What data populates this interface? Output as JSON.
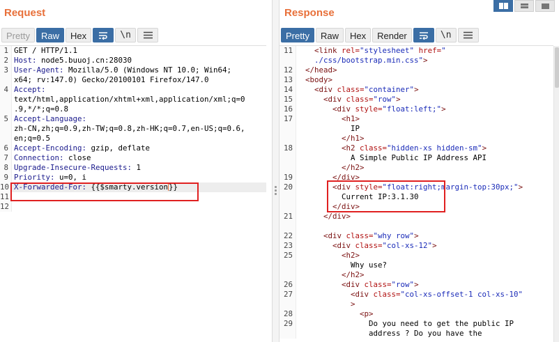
{
  "request": {
    "title": "Request",
    "tabs": [
      {
        "label": "Pretty"
      },
      {
        "label": "Raw"
      },
      {
        "label": "Hex"
      }
    ],
    "active_tab": "Raw",
    "icons": [
      "wrap-lines-icon",
      "newline-icon",
      "menu-icon"
    ],
    "newline_glyph": "\\n",
    "lines": [
      {
        "num": "1",
        "segs": [
          {
            "t": "GET / HTTP/1.1",
            "c": ""
          }
        ]
      },
      {
        "num": "2",
        "segs": [
          {
            "t": "Host: ",
            "c": "k"
          },
          {
            "t": "node5.buuoj.cn:28030",
            "c": ""
          }
        ]
      },
      {
        "num": "3",
        "segs": [
          {
            "t": "User-Agent: ",
            "c": "k"
          },
          {
            "t": "Mozilla/5.0 (Windows NT 10.0; Win64;",
            "c": ""
          }
        ]
      },
      {
        "num": "",
        "segs": [
          {
            "t": "x64; rv:147.0) Gecko/20100101 Firefox/147.0",
            "c": ""
          }
        ]
      },
      {
        "num": "4",
        "segs": [
          {
            "t": "Accept:",
            "c": "k"
          }
        ]
      },
      {
        "num": "",
        "segs": [
          {
            "t": "text/html,application/xhtml+xml,application/xml;q=0",
            "c": ""
          }
        ]
      },
      {
        "num": "",
        "segs": [
          {
            "t": ".9,*/*;q=0.8",
            "c": ""
          }
        ]
      },
      {
        "num": "5",
        "segs": [
          {
            "t": "Accept-Language:",
            "c": "k"
          }
        ]
      },
      {
        "num": "",
        "segs": [
          {
            "t": "zh-CN,zh;q=0.9,zh-TW;q=0.8,zh-HK;q=0.7,en-US;q=0.6,",
            "c": ""
          }
        ]
      },
      {
        "num": "",
        "segs": [
          {
            "t": "en;q=0.5",
            "c": ""
          }
        ]
      },
      {
        "num": "6",
        "segs": [
          {
            "t": "Accept-Encoding: ",
            "c": "k"
          },
          {
            "t": "gzip, deflate",
            "c": ""
          }
        ]
      },
      {
        "num": "7",
        "segs": [
          {
            "t": "Connection: ",
            "c": "k"
          },
          {
            "t": "close",
            "c": ""
          }
        ]
      },
      {
        "num": "8",
        "segs": [
          {
            "t": "Upgrade-Insecure-Requests: ",
            "c": "k"
          },
          {
            "t": "1",
            "c": ""
          }
        ]
      },
      {
        "num": "9",
        "segs": [
          {
            "t": "Priority: ",
            "c": "k"
          },
          {
            "t": "u=0, i",
            "c": ""
          }
        ]
      },
      {
        "num": "10",
        "segs": [
          {
            "t": "X-Forwarded-For: ",
            "c": "k"
          },
          {
            "t": "{{$smarty.version",
            "c": ""
          },
          {
            "t": "|caret|",
            "c": "caret"
          },
          {
            "t": "}}",
            "c": ""
          }
        ],
        "current": true
      },
      {
        "num": "11",
        "segs": []
      },
      {
        "num": "12",
        "segs": []
      }
    ]
  },
  "response": {
    "title": "Response",
    "tabs": [
      {
        "label": "Pretty"
      },
      {
        "label": "Raw"
      },
      {
        "label": "Hex"
      },
      {
        "label": "Render"
      }
    ],
    "active_tab": "Pretty",
    "icons": [
      "wrap-lines-icon",
      "newline-icon",
      "menu-icon"
    ],
    "newline_glyph": "\\n",
    "lines": [
      {
        "num": "11",
        "segs": [
          {
            "t": "    ",
            "c": ""
          },
          {
            "t": "<link ",
            "c": "t"
          },
          {
            "t": "rel=",
            "c": "a"
          },
          {
            "t": "\"stylesheet\" ",
            "c": "v"
          },
          {
            "t": "href=",
            "c": "a"
          },
          {
            "t": "\"",
            "c": "v"
          }
        ]
      },
      {
        "num": "",
        "segs": [
          {
            "t": "    ",
            "c": ""
          },
          {
            "t": "./css/bootstrap.min.css\"",
            "c": "v"
          },
          {
            "t": ">",
            "c": "t"
          }
        ]
      },
      {
        "num": "12",
        "segs": [
          {
            "t": "  ",
            "c": ""
          },
          {
            "t": "</head>",
            "c": "t"
          }
        ]
      },
      {
        "num": "13",
        "segs": [
          {
            "t": "  ",
            "c": ""
          },
          {
            "t": "<body>",
            "c": "t"
          }
        ]
      },
      {
        "num": "14",
        "segs": [
          {
            "t": "    ",
            "c": ""
          },
          {
            "t": "<div ",
            "c": "t"
          },
          {
            "t": "class=",
            "c": "a"
          },
          {
            "t": "\"container\"",
            "c": "v"
          },
          {
            "t": ">",
            "c": "t"
          }
        ]
      },
      {
        "num": "15",
        "segs": [
          {
            "t": "      ",
            "c": ""
          },
          {
            "t": "<div ",
            "c": "t"
          },
          {
            "t": "class=",
            "c": "a"
          },
          {
            "t": "\"row\"",
            "c": "v"
          },
          {
            "t": ">",
            "c": "t"
          }
        ]
      },
      {
        "num": "16",
        "segs": [
          {
            "t": "        ",
            "c": ""
          },
          {
            "t": "<div ",
            "c": "t"
          },
          {
            "t": "style=",
            "c": "a"
          },
          {
            "t": "\"float:left;\"",
            "c": "v"
          },
          {
            "t": ">",
            "c": "t"
          }
        ]
      },
      {
        "num": "17",
        "segs": [
          {
            "t": "          ",
            "c": ""
          },
          {
            "t": "<h1>",
            "c": "t"
          }
        ]
      },
      {
        "num": "",
        "segs": [
          {
            "t": "            IP",
            "c": ""
          }
        ]
      },
      {
        "num": "",
        "segs": [
          {
            "t": "          ",
            "c": ""
          },
          {
            "t": "</h1>",
            "c": "t"
          }
        ]
      },
      {
        "num": "18",
        "segs": [
          {
            "t": "          ",
            "c": ""
          },
          {
            "t": "<h2 ",
            "c": "t"
          },
          {
            "t": "class=",
            "c": "a"
          },
          {
            "t": "\"hidden-xs hidden-sm\"",
            "c": "v"
          },
          {
            "t": ">",
            "c": "t"
          }
        ]
      },
      {
        "num": "",
        "segs": [
          {
            "t": "            A Simple Public IP Address API",
            "c": ""
          }
        ]
      },
      {
        "num": "",
        "segs": [
          {
            "t": "          ",
            "c": ""
          },
          {
            "t": "</h2>",
            "c": "t"
          }
        ]
      },
      {
        "num": "19",
        "segs": [
          {
            "t": "        ",
            "c": ""
          },
          {
            "t": "</div>",
            "c": "t"
          }
        ]
      },
      {
        "num": "20",
        "segs": [
          {
            "t": "        ",
            "c": ""
          },
          {
            "t": "<div ",
            "c": "t"
          },
          {
            "t": "style=",
            "c": "a"
          },
          {
            "t": "\"float:right;margin-top:30px;\"",
            "c": "v"
          },
          {
            "t": ">",
            "c": "t"
          }
        ]
      },
      {
        "num": "",
        "segs": [
          {
            "t": "          Current IP:3.1.30",
            "c": ""
          }
        ]
      },
      {
        "num": "",
        "segs": [
          {
            "t": "        ",
            "c": ""
          },
          {
            "t": "</div>",
            "c": "t"
          }
        ]
      },
      {
        "num": "21",
        "segs": [
          {
            "t": "      ",
            "c": ""
          },
          {
            "t": "</div>",
            "c": "t"
          }
        ]
      },
      {
        "num": "",
        "segs": []
      },
      {
        "num": "22",
        "segs": [
          {
            "t": "      ",
            "c": ""
          },
          {
            "t": "<div ",
            "c": "t"
          },
          {
            "t": "class=",
            "c": "a"
          },
          {
            "t": "\"why row\"",
            "c": "v"
          },
          {
            "t": ">",
            "c": "t"
          }
        ]
      },
      {
        "num": "23",
        "segs": [
          {
            "t": "        ",
            "c": ""
          },
          {
            "t": "<div ",
            "c": "t"
          },
          {
            "t": "class=",
            "c": "a"
          },
          {
            "t": "\"col-xs-12\"",
            "c": "v"
          },
          {
            "t": ">",
            "c": "t"
          }
        ]
      },
      {
        "num": "25",
        "segs": [
          {
            "t": "          ",
            "c": ""
          },
          {
            "t": "<h2>",
            "c": "t"
          }
        ]
      },
      {
        "num": "",
        "segs": [
          {
            "t": "            Why use?",
            "c": ""
          }
        ]
      },
      {
        "num": "",
        "segs": [
          {
            "t": "          ",
            "c": ""
          },
          {
            "t": "</h2>",
            "c": "t"
          }
        ]
      },
      {
        "num": "26",
        "segs": [
          {
            "t": "          ",
            "c": ""
          },
          {
            "t": "<div ",
            "c": "t"
          },
          {
            "t": "class=",
            "c": "a"
          },
          {
            "t": "\"row\"",
            "c": "v"
          },
          {
            "t": ">",
            "c": "t"
          }
        ]
      },
      {
        "num": "27",
        "segs": [
          {
            "t": "            ",
            "c": ""
          },
          {
            "t": "<div ",
            "c": "t"
          },
          {
            "t": "class=",
            "c": "a"
          },
          {
            "t": "\"col-xs-offset-1 col-xs-10\"",
            "c": "v"
          }
        ]
      },
      {
        "num": "",
        "segs": [
          {
            "t": "            ",
            "c": ""
          },
          {
            "t": ">",
            "c": "t"
          }
        ]
      },
      {
        "num": "28",
        "segs": [
          {
            "t": "              ",
            "c": ""
          },
          {
            "t": "<p>",
            "c": "t"
          }
        ]
      },
      {
        "num": "29",
        "segs": [
          {
            "t": "                Do you need to get the public IP",
            "c": ""
          }
        ]
      },
      {
        "num": "",
        "segs": [
          {
            "t": "                address ? Do you have the",
            "c": ""
          }
        ]
      }
    ]
  },
  "colors": {
    "accent_orange": "#e8703a",
    "active_blue": "#3b6ea5",
    "highlight_red": "#e02020"
  }
}
